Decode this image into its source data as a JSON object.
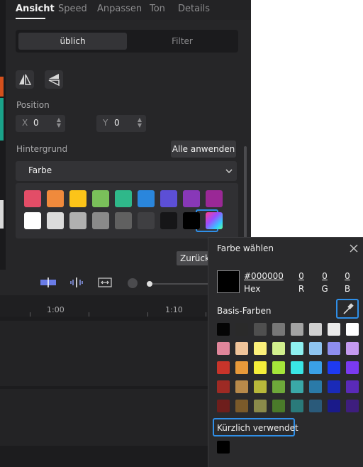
{
  "properties_panel": {
    "tabs": [
      "Ansicht",
      "Speed",
      "Anpassen",
      "Ton",
      "Details"
    ],
    "active_tab": "Ansicht",
    "segmented": {
      "left_label": "üblich",
      "right_label": "Filter"
    },
    "position_label": "Position",
    "x": {
      "axis_label": "X",
      "value": "0"
    },
    "y": {
      "axis_label": "Y",
      "value": "0"
    },
    "background_label": "Hintergrund",
    "apply_all_label": "Alle anwenden",
    "fill_select_value": "Farbe",
    "swatches_row1": [
      "#e34d67",
      "#f08a3c",
      "#fcc419",
      "#7ac05a",
      "#2fb88a",
      "#2a86dc",
      "#5c4fd6",
      "#8838b8",
      "#9a2896"
    ],
    "swatches_row2": [
      "#ffffff",
      "#dcdcdc",
      "#b0b0b0",
      "#8a8a8a",
      "#606060",
      "#3f3f42",
      "#161618",
      "#000000",
      "gradient"
    ],
    "back_label": "Zurück"
  },
  "timeline": {
    "time_labels": [
      "1:00",
      "1:10"
    ]
  },
  "color_dialog": {
    "title": "Farbe wählen",
    "hex_value": "#000000",
    "hex_label": "Hex",
    "channels": [
      {
        "label": "R",
        "value": "0"
      },
      {
        "label": "G",
        "value": "0"
      },
      {
        "label": "B",
        "value": "0"
      }
    ],
    "basic_colors_label": "Basis-Farben",
    "basic_colors": [
      [
        "#050505",
        "#2a2a2a",
        "#4f4f4f",
        "#777777",
        "#a3a3a3",
        "#d0d0d0",
        "#ebebeb",
        "#ffffff"
      ],
      [
        "#e0869b",
        "#f0c49a",
        "#fbf07a",
        "#d2f08e",
        "#8ef0f0",
        "#8ec4f0",
        "#8e8ef0",
        "#c49af0"
      ],
      [
        "#c8342a",
        "#e89a3a",
        "#f5ee3a",
        "#a6e63a",
        "#3ae6e6",
        "#3aa0e6",
        "#1e3af0",
        "#7a3af0"
      ],
      [
        "#9e2a24",
        "#b88a4a",
        "#b8b83a",
        "#6ea83a",
        "#3aa8a8",
        "#2a7aa8",
        "#1a2ab8",
        "#5a2ab8"
      ],
      [
        "#6e1e1c",
        "#7a5a2a",
        "#8a8a4a",
        "#4a7a2a",
        "#2a7a7a",
        "#2a5a7a",
        "#1a1a8a",
        "#3e1e7e"
      ]
    ],
    "recent_label": "Kürzlich verwendet",
    "recent_colors": [
      "#000000"
    ],
    "accent": "#2f8fe8"
  }
}
